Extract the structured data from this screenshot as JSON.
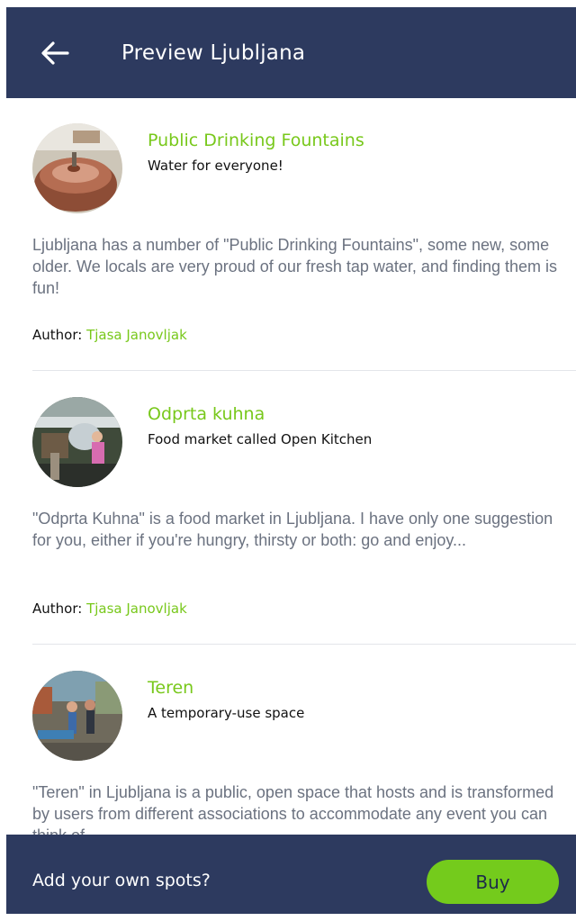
{
  "header": {
    "title": "Preview Ljubljana",
    "back_icon": "arrow-left-icon"
  },
  "spots": [
    {
      "title": "Public Drinking Fountains",
      "subtitle": "Water for everyone!",
      "description": "Ljubljana has a number of \"Public Drinking Fountains\", some new, some older. We locals are very proud of our fresh tap water, and finding them is fun!",
      "author_label": "Author:",
      "author_name": "Tjasa Janovljak"
    },
    {
      "title": "Odprta kuhna",
      "subtitle": "Food market called Open Kitchen",
      "description": "\"Odprta Kuhna\" is a food market in Ljubljana. I have only one suggestion for you, either if you're hungry, thirsty or both: go and enjoy...",
      "author_label": "Author:",
      "author_name": "Tjasa Janovljak"
    },
    {
      "title": "Teren",
      "subtitle": "A temporary-use space",
      "description": "\"Teren\" in Ljubljana is a public, open space that hosts and is transformed by users from different associations to accommodate any event you can think of...",
      "author_label": "",
      "author_name": ""
    }
  ],
  "footer": {
    "cta_text": "Add your own spots?",
    "buy_label": "Buy"
  },
  "colors": {
    "navy": "#2d3a5f",
    "accent_green": "#78c81b",
    "text_gray": "#6b7280"
  }
}
